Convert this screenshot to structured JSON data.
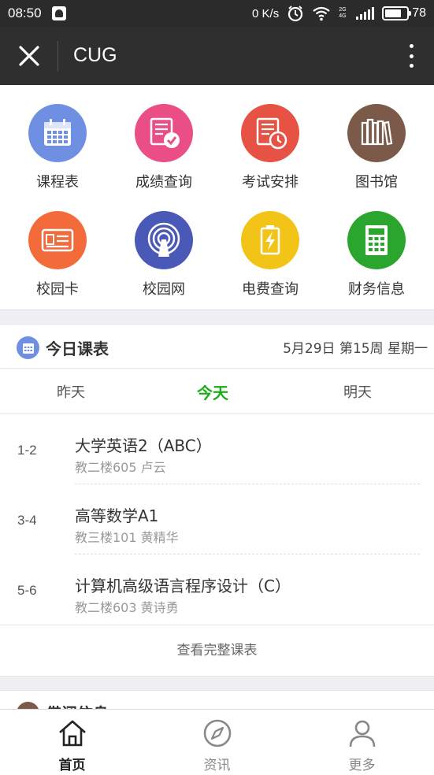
{
  "status_bar": {
    "time": "08:50",
    "speed": "0 K/s",
    "network": "2G 4G",
    "battery": "78"
  },
  "title_bar": {
    "title": "CUG"
  },
  "grid": [
    {
      "label": "课程表",
      "icon": "calendar-icon",
      "color": "#6f8fe3"
    },
    {
      "label": "成绩查询",
      "icon": "grade-checklist-icon",
      "color": "#e94f84"
    },
    {
      "label": "考试安排",
      "icon": "exam-clock-icon",
      "color": "#e65345"
    },
    {
      "label": "图书馆",
      "icon": "books-icon",
      "color": "#7b5a4a"
    },
    {
      "label": "校园卡",
      "icon": "campus-card-icon",
      "color": "#f46b3b"
    },
    {
      "label": "校园网",
      "icon": "wireless-icon",
      "color": "#4a59b8"
    },
    {
      "label": "电费查询",
      "icon": "battery-bolt-icon",
      "color": "#f3c418"
    },
    {
      "label": "财务信息",
      "icon": "calculator-icon",
      "color": "#2aa52e"
    }
  ],
  "schedule": {
    "heading": "今日课表",
    "date": "5月29日 第15周 星期一",
    "tabs": [
      "昨天",
      "今天",
      "明天"
    ],
    "active_tab": "今天",
    "courses": [
      {
        "period": "1-2",
        "name": "大学英语2（ABC）",
        "info": "教二楼605 卢云"
      },
      {
        "period": "3-4",
        "name": "高等数学A1",
        "info": "教三楼101 黄精华"
      },
      {
        "period": "5-6",
        "name": "计算机高级语言程序设计（C）",
        "info": "教二楼603 黄诗勇"
      }
    ],
    "view_all": "查看完整课表"
  },
  "next_section": {
    "heading": "借阅信息"
  },
  "bottom_nav": [
    {
      "label": "首页",
      "icon": "home-icon",
      "active": true
    },
    {
      "label": "资讯",
      "icon": "compass-icon",
      "active": false
    },
    {
      "label": "更多",
      "icon": "person-icon",
      "active": false
    }
  ]
}
